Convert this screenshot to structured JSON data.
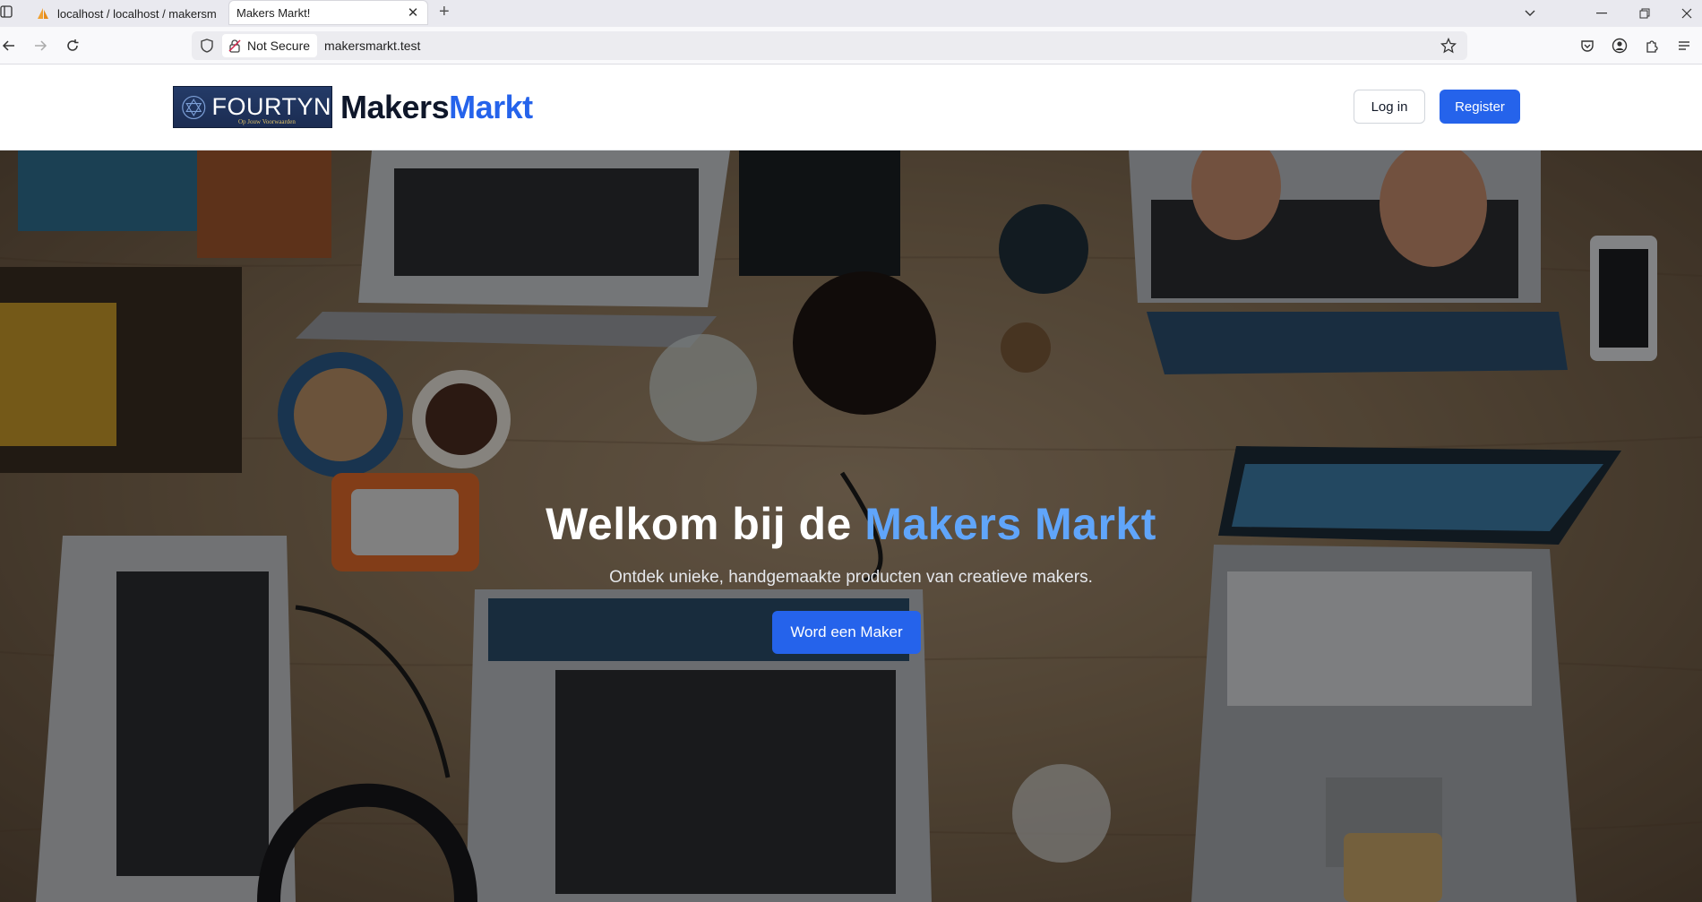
{
  "browser": {
    "tabs": [
      {
        "label": "localhost / localhost / makersm",
        "active": false,
        "icon": "phpmyadmin-sail-icon"
      },
      {
        "label": "Makers Markt!",
        "active": true,
        "icon": ""
      }
    ],
    "address": {
      "security_label": "Not Secure",
      "url": "makersmarkt.test"
    }
  },
  "header": {
    "partner_logo_text": "FOURTYN",
    "partner_logo_tagline": "Op Jouw Voorwaarden",
    "brand_part1": "Makers",
    "brand_part2": "Markt",
    "login_label": "Log in",
    "register_label": "Register"
  },
  "hero": {
    "title_prefix": "Welkom bij de",
    "title_accent": "Makers Markt",
    "subtitle": "Ontdek unieke, handgemaakte producten van creatieve makers.",
    "cta_label": "Word een Maker"
  },
  "colors": {
    "primary": "#2563eb",
    "accent_light": "#60a5fa",
    "dark_text": "#0f172a"
  }
}
